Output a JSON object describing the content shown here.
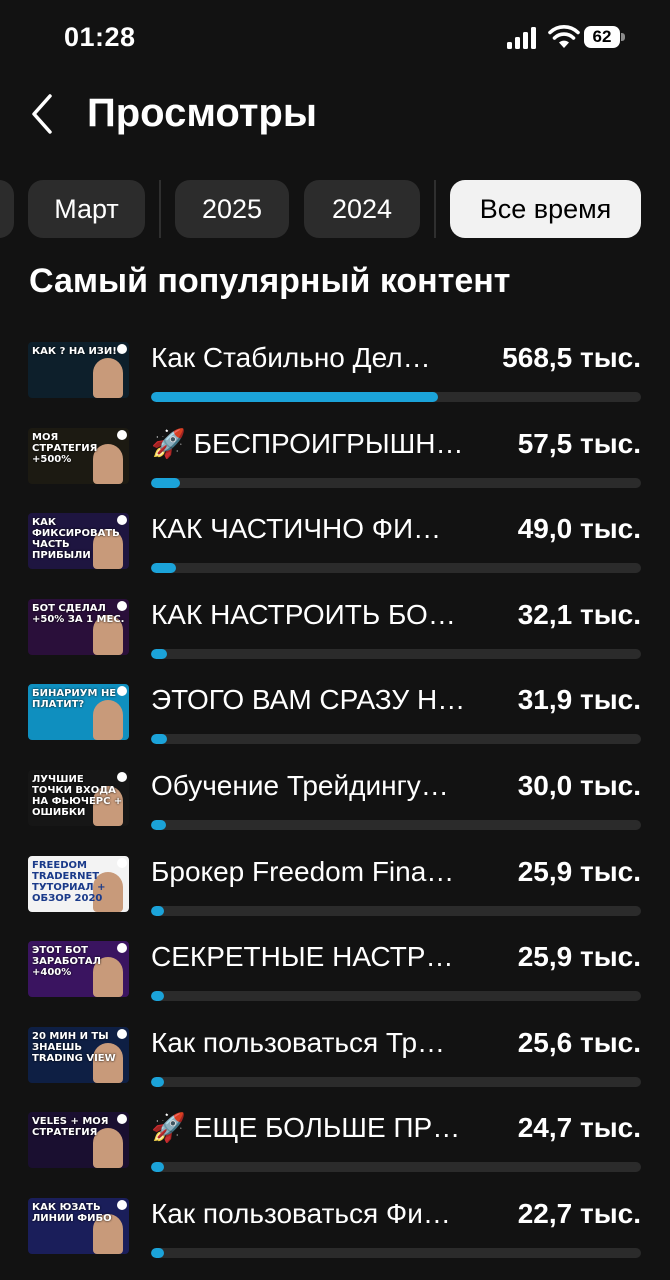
{
  "status": {
    "time": "01:28",
    "battery": "62"
  },
  "header": {
    "title": "Просмотры"
  },
  "filters": [
    "Март",
    "2025",
    "2024",
    "Все время"
  ],
  "active_filter": "Все время",
  "section_title": "Самый популярный контент",
  "items": [
    {
      "title": "Как Стабильно Дел…",
      "views": "568,5 тыс.",
      "share": 0.586,
      "thumb_text": "КАК ? НА ИЗИ!",
      "thumb_bg": "#0d1f2b"
    },
    {
      "title": "🚀 БЕСПРОИГРЫШН…",
      "views": "57,5 тыс.",
      "share": 0.06,
      "thumb_text": "МОЯ СТРАТЕГИЯ +500%",
      "thumb_bg": "#1c1a12"
    },
    {
      "title": "КАК ЧАСТИЧНО ФИ…",
      "views": "49,0 тыс.",
      "share": 0.05,
      "thumb_text": "КАК ФИКСИРОВАТЬ ЧАСТЬ ПРИБЫЛИ",
      "thumb_bg": "#1e1540"
    },
    {
      "title": "КАК НАСТРОИТЬ БО…",
      "views": "32,1 тыс.",
      "share": 0.033,
      "thumb_text": "БОТ СДЕЛАЛ +50% ЗА 1 МЕС.",
      "thumb_bg": "#2a0f3a"
    },
    {
      "title": "ЭТОГО ВАМ СРАЗУ Н…",
      "views": "31,9 тыс.",
      "share": 0.033,
      "thumb_text": "БИНАРИУМ НЕ ПЛАТИТ?",
      "thumb_bg": "#0f8fbf"
    },
    {
      "title": "Обучение Трейдингу…",
      "views": "30,0 тыс.",
      "share": 0.031,
      "thumb_text": "ЛУЧШИЕ ТОЧКИ ВХОДА НА ФЬЮЧЕРС + ОШИБКИ",
      "thumb_bg": "#161616"
    },
    {
      "title": "Брокер Freedom Fina…",
      "views": "25,9 тыс.",
      "share": 0.027,
      "thumb_text": "FREEDOM TRADERNET ТУТОРИАЛ + ОБЗОР 2020",
      "thumb_bg": "#f3f3f3"
    },
    {
      "title": "СЕКРЕТНЫЕ НАСТР…",
      "views": "25,9 тыс.",
      "share": 0.027,
      "thumb_text": "ЭТОТ БОТ ЗАРАБОТАЛ +400%",
      "thumb_bg": "#3a1460"
    },
    {
      "title": "Как пользоваться Тр…",
      "views": "25,6 тыс.",
      "share": 0.026,
      "thumb_text": "20 МИН И ТЫ ЗНАЕШЬ TRADING VIEW",
      "thumb_bg": "#0e1f44"
    },
    {
      "title": "🚀 ЕЩЕ БОЛЬШЕ ПР…",
      "views": "24,7 тыс.",
      "share": 0.026,
      "thumb_text": "VELES + МОЯ СТРАТЕГИЯ",
      "thumb_bg": "#1a0f30"
    },
    {
      "title": "Как пользоваться Фи…",
      "views": "22,7 тыс.",
      "share": 0.026,
      "thumb_text": "КАК ЮЗАТЬ ЛИНИИ ФИБО",
      "thumb_bg": "#1a1e5a"
    }
  ]
}
